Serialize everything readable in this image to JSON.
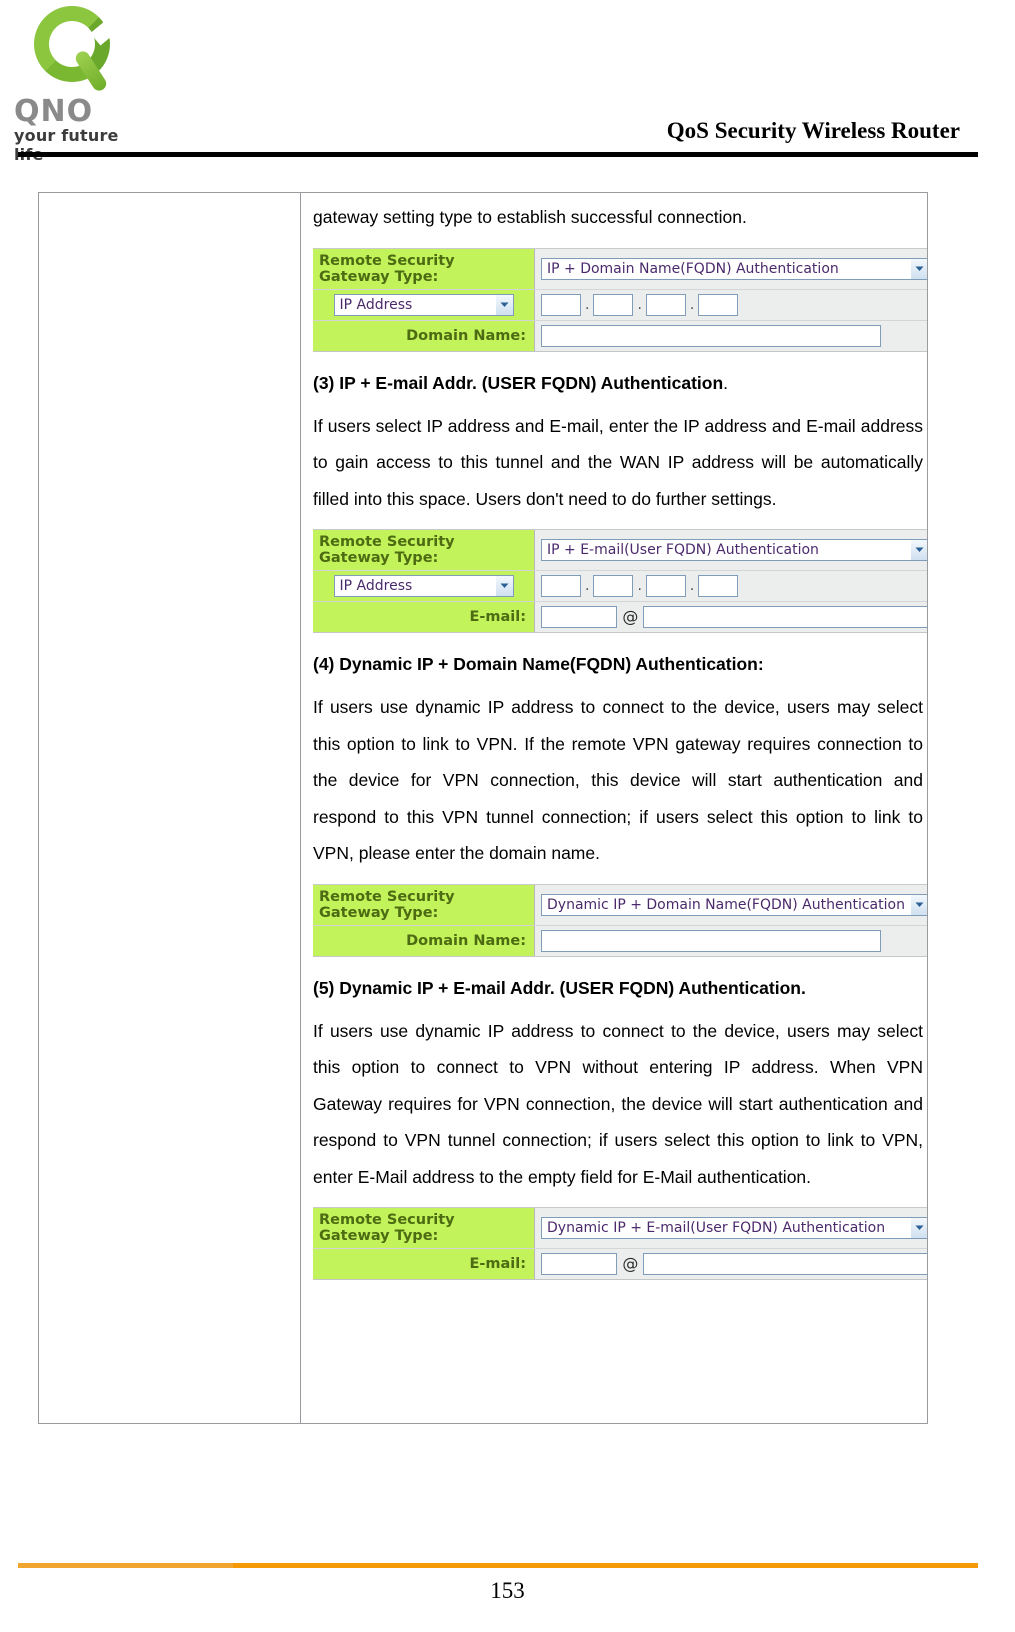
{
  "header": {
    "logo_word": "QNO",
    "logo_tagline": "your future life",
    "title": "QoS Security Wireless Router"
  },
  "content": {
    "intro_text": "gateway setting type to establish successful connection.",
    "section3": {
      "heading": "(3) IP + E-mail Addr. (USER FQDN) Authentication",
      "heading_tail": ".",
      "body": "If users select IP address and E-mail, enter the IP address and E-mail address to gain access to this tunnel and the WAN IP address will be automatically filled into this space. Users don't need to do further settings."
    },
    "section4": {
      "heading": "(4) Dynamic IP + Domain Name(FQDN) Authentication:",
      "body": "If users use dynamic IP address to connect to the device, users may select this option to link to VPN. If the remote VPN gateway requires connection to the device for VPN connection, this device will start authentication and respond to this VPN tunnel connection; if users select this option to link to VPN, please enter the domain name."
    },
    "section5": {
      "heading": "(5) Dynamic IP + E-mail Addr. (USER FQDN) Authentication.",
      "body": "If users use dynamic IP address to connect to the device, users may select this option to connect to VPN without entering IP address. When VPN Gateway requires for VPN connection, the device will start authentication and respond to VPN tunnel connection; if users select this option to link to VPN, enter E-Mail address to the empty field for E-Mail authentication."
    }
  },
  "ui_shots": {
    "shot1": {
      "name": "remote-security-gateway-ip-domain",
      "row1_label": "Remote Security Gateway Type:",
      "row1_select_value": "IP + Domain Name(FQDN) Authentication",
      "row2_select_value": "IP Address",
      "row2_octets": [
        "",
        "",
        "",
        ""
      ],
      "row3_label": "Domain Name:",
      "row3_value": ""
    },
    "shot2": {
      "name": "remote-security-gateway-ip-email",
      "row1_label": "Remote Security Gateway Type:",
      "row1_select_value": "IP + E-mail(User FQDN) Authentication",
      "row2_select_value": "IP Address",
      "row2_octets": [
        "",
        "",
        "",
        ""
      ],
      "row3_label": "E-mail:",
      "row3_user": "",
      "row3_at": "@",
      "row3_domain": ""
    },
    "shot3": {
      "name": "remote-security-gateway-dynamic-domain",
      "row1_label": "Remote Security Gateway Type:",
      "row1_select_value": "Dynamic IP + Domain Name(FQDN) Authentication",
      "row2_label": "Domain Name:",
      "row2_value": ""
    },
    "shot4": {
      "name": "remote-security-gateway-dynamic-email",
      "row1_label": "Remote Security Gateway Type:",
      "row1_select_value": "Dynamic IP + E-mail(User FQDN) Authentication",
      "row2_label": "E-mail:",
      "row2_user": "",
      "row2_at": "@",
      "row2_domain": ""
    }
  },
  "footer": {
    "page_number": "153"
  },
  "colors": {
    "label_green": "#c3f35a",
    "label_text": "#4c6b12",
    "select_text": "#4b2a6b",
    "footer_rule": "#f59a06",
    "header_rule": "#000000"
  }
}
